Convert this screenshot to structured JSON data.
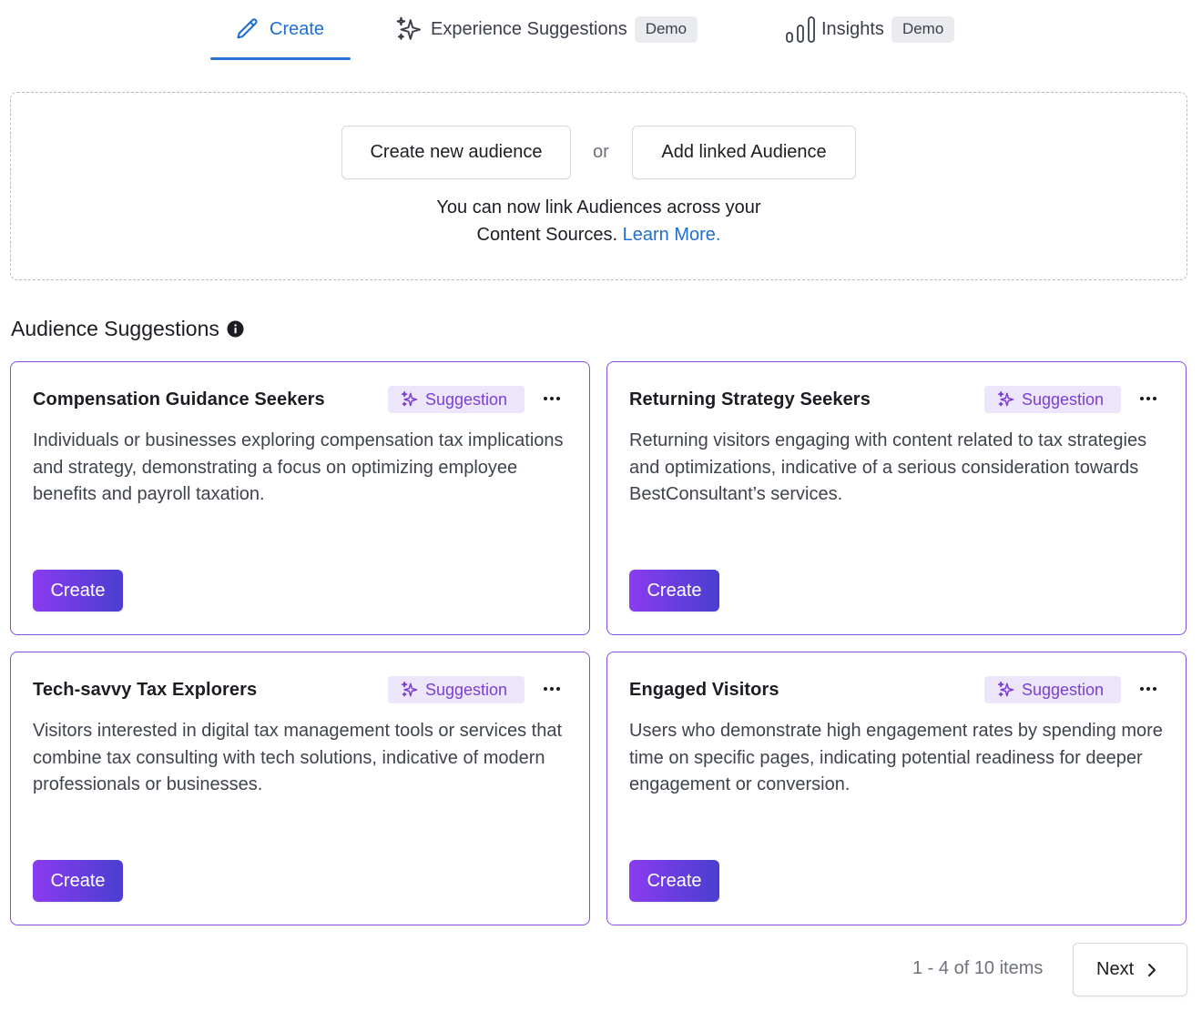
{
  "tabs": {
    "create": {
      "label": "Create"
    },
    "experience": {
      "label": "Experience Suggestions",
      "badge": "Demo"
    },
    "insights": {
      "label": "Insights",
      "badge": "Demo"
    }
  },
  "create_box": {
    "new_audience_label": "Create new audience",
    "or_text": "or",
    "linked_audience_label": "Add linked Audience",
    "info_line1": "You can now link Audiences across your",
    "info_line2": "Content Sources.",
    "learn_more": "Learn More."
  },
  "section": {
    "title": "Audience Suggestions"
  },
  "cards": [
    {
      "title": "Compensation Guidance Seekers",
      "badge": "Suggestion",
      "description": "Individuals or businesses exploring compensation tax implications and strategy, demonstrating a focus on optimizing employee benefits and payroll taxation.",
      "button": "Create"
    },
    {
      "title": "Returning Strategy Seekers",
      "badge": "Suggestion",
      "description": "Returning visitors engaging with content related to tax strategies and optimizations, indicative of a serious consideration towards BestConsultant’s services.",
      "button": "Create"
    },
    {
      "title": "Tech-savvy Tax Explorers",
      "badge": "Suggestion",
      "description": "Visitors interested in digital tax management tools or services that combine tax consulting with tech solutions, indicative of modern professionals or businesses.",
      "button": "Create"
    },
    {
      "title": "Engaged Visitors",
      "badge": "Suggestion",
      "description": "Users who demonstrate high engagement rates by spending more time on specific pages, indicating potential readiness for deeper engagement or conversion.",
      "button": "Create"
    }
  ],
  "pagination": {
    "count_text": "1 - 4 of 10 items",
    "next_label": "Next"
  },
  "colors": {
    "accent_blue": "#1f6fd1",
    "accent_purple": "#8a4fd8",
    "button_gradient_start": "#8a3cf0",
    "button_gradient_end": "#4a3ed0"
  },
  "icons": {
    "create_tab": "pencil-icon",
    "experience_tab": "sparkle-icon",
    "insights_tab": "bar-chart-icon",
    "suggestion_badge": "sparkle-icon",
    "more": "more-dots-icon",
    "next": "chevron-right-icon",
    "info": "info-icon"
  }
}
